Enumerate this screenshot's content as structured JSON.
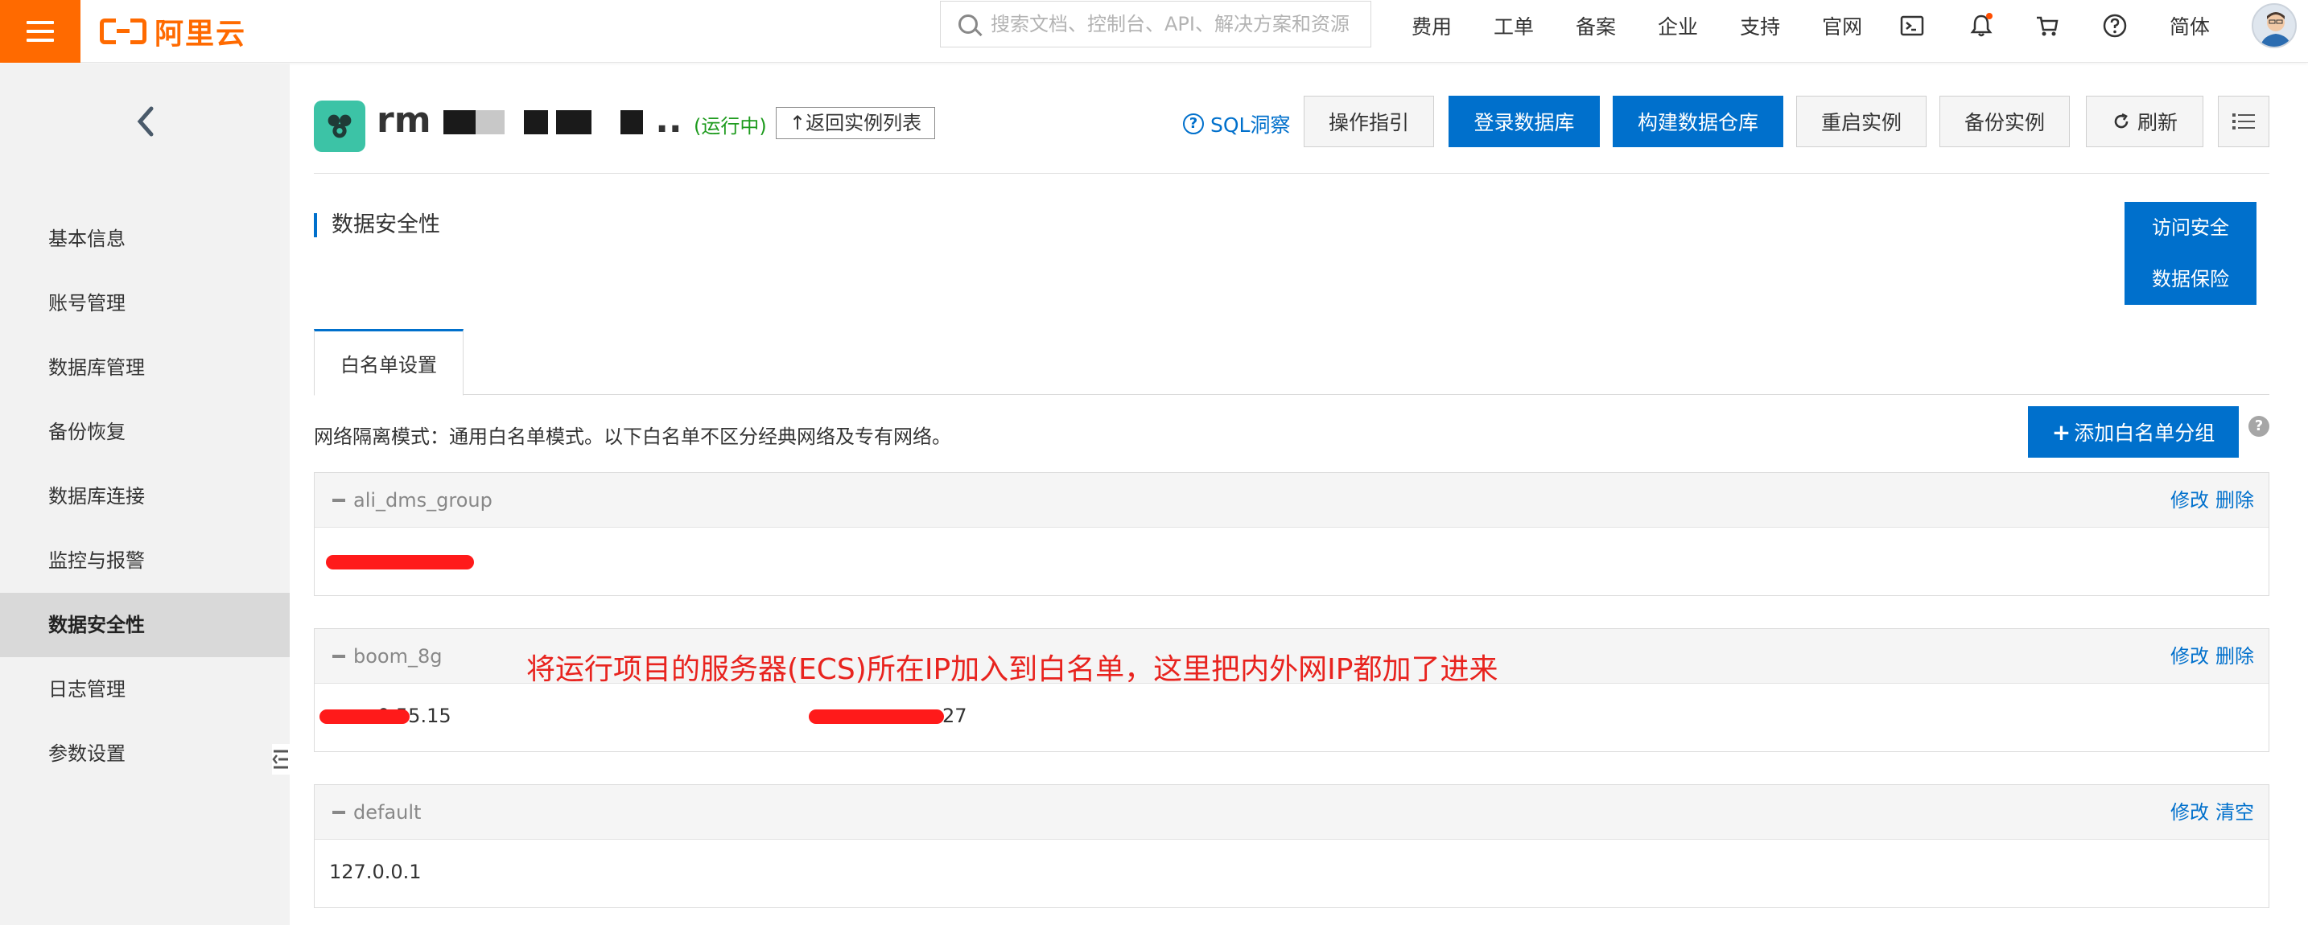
{
  "topbar": {
    "logo_text": "阿里云",
    "search_placeholder": "搜索文档、控制台、API、解决方案和资源",
    "nav": [
      "费用",
      "工单",
      "备案",
      "企业",
      "支持",
      "官网"
    ],
    "lang": "简体",
    "icons": [
      "terminal-icon",
      "bell-icon",
      "cart-icon",
      "help-icon"
    ],
    "notification_color": "#ff4d00"
  },
  "sidebar": {
    "items": [
      "基本信息",
      "账号管理",
      "数据库管理",
      "备份恢复",
      "数据库连接",
      "监控与报警",
      "数据安全性",
      "日志管理",
      "参数设置"
    ],
    "active": "数据安全性"
  },
  "header": {
    "instance_prefix": "rm",
    "instance_suffix": "..",
    "status": "(运行中)",
    "back_to_list": "返回实例列表",
    "sql_insight": "SQL洞察",
    "buttons": {
      "guide": "操作指引",
      "login_db": "登录数据库",
      "build_warehouse": "构建数据仓库",
      "restart": "重启实例",
      "backup": "备份实例",
      "refresh": "刷新"
    }
  },
  "section": {
    "title": "数据安全性",
    "side_actions": [
      "访问安全",
      "数据保险"
    ],
    "tab": "白名单设置",
    "network_mode": "网络隔离模式：通用白名单模式。以下白名单不区分经典网络及专有网络。",
    "add_group": "添加白名单分组"
  },
  "groups": [
    {
      "name": "ali_dms_group",
      "ops": [
        "修改",
        "删除"
      ],
      "ips": []
    },
    {
      "name": "boom_8g",
      "ops": [
        "修改",
        "删除"
      ],
      "ips": [
        "0.55.15",
        "27"
      ]
    },
    {
      "name": "default",
      "ops": [
        "修改",
        "清空"
      ],
      "ips": [
        "127.0.0.1"
      ]
    }
  ],
  "annotation": "将运行项目的服务器(ECS)所在IP加入到白名单，这里把内外网IP都加了进来",
  "colors": {
    "brand_orange": "#ff6a00",
    "primary_blue": "#0070cc",
    "status_green": "#1e9b1e",
    "annotation_red": "#e8231e"
  }
}
